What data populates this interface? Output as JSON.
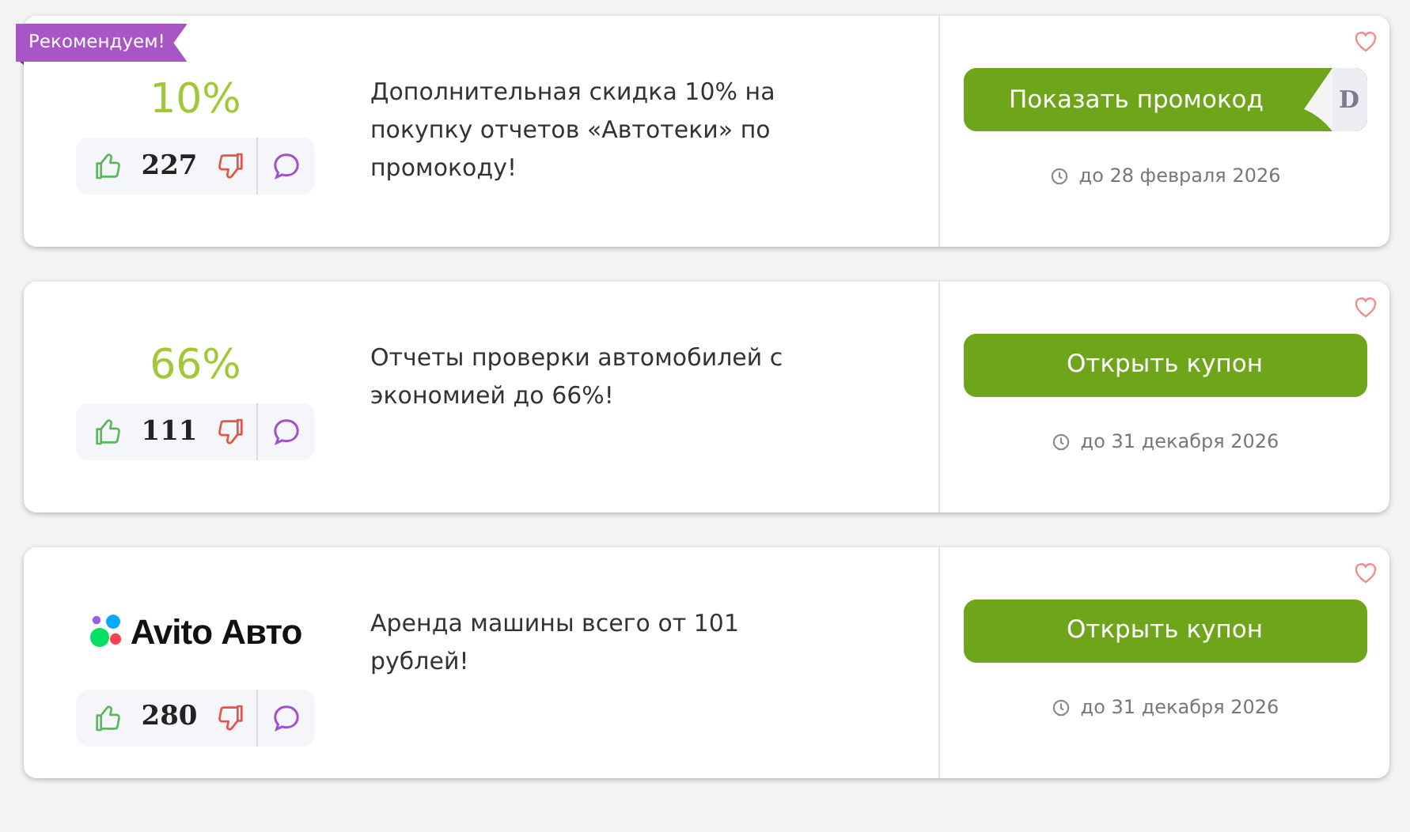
{
  "coupons": [
    {
      "badge": "Рекомендуем!",
      "head": {
        "kind": "discount",
        "text": "10%"
      },
      "votes": "227",
      "description": "Дополнительная скидка 10% на покупку отчетов «Автотеки» по промокоду!",
      "action": {
        "kind": "promo",
        "label": "Показать промокод",
        "code_peek": "D"
      },
      "expires": "до 28 февраля 2026"
    },
    {
      "head": {
        "kind": "discount",
        "text": "66%"
      },
      "votes": "111",
      "description": "Отчеты проверки автомобилей с экономией до 66%!",
      "action": {
        "kind": "coupon",
        "label": "Открыть купон"
      },
      "expires": "до 31 декабря 2026"
    },
    {
      "head": {
        "kind": "logo",
        "text": "Avito Авто"
      },
      "votes": "280",
      "description": "Аренда машины всего от 101 рублей!",
      "action": {
        "kind": "coupon",
        "label": "Открыть купон"
      },
      "expires": "до 31 декабря 2026"
    }
  ]
}
